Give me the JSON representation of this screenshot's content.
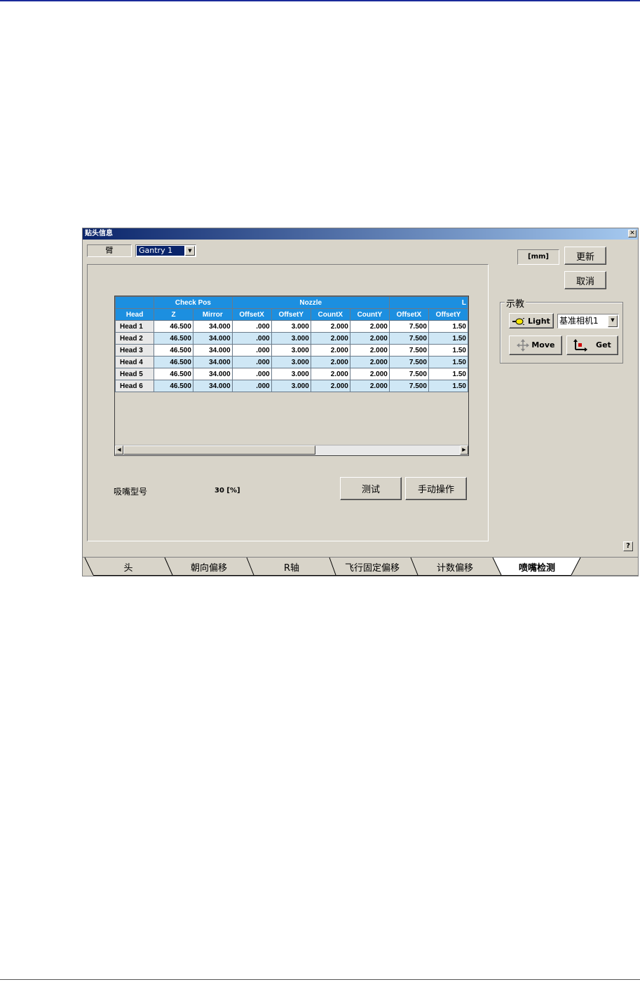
{
  "window": {
    "title": "贴头信息",
    "close_glyph": "✕"
  },
  "gantry": {
    "label": "臂",
    "selected": "Gantry 1"
  },
  "unit_label": "[mm]",
  "buttons": {
    "update": "更新",
    "cancel": "取消",
    "test": "测试",
    "manual": "手动操作",
    "help": "?"
  },
  "teach": {
    "legend": "示教",
    "light_label": "Light",
    "camera_selected": "基准相机1",
    "move_label": "Move",
    "get_label": "Get"
  },
  "table": {
    "group_headers": [
      "Check Pos",
      "Nozzle",
      "L"
    ],
    "columns": [
      "Head",
      "Z",
      "Mirror",
      "OffsetX",
      "OffsetY",
      "CountX",
      "CountY",
      "OffsetX",
      "OffsetY"
    ],
    "rows": [
      [
        "Head 1",
        "46.500",
        "34.000",
        ".000",
        "3.000",
        "2.000",
        "2.000",
        "7.500",
        "1.50"
      ],
      [
        "Head 2",
        "46.500",
        "34.000",
        ".000",
        "3.000",
        "2.000",
        "2.000",
        "7.500",
        "1.50"
      ],
      [
        "Head 3",
        "46.500",
        "34.000",
        ".000",
        "3.000",
        "2.000",
        "2.000",
        "7.500",
        "1.50"
      ],
      [
        "Head 4",
        "46.500",
        "34.000",
        ".000",
        "3.000",
        "2.000",
        "2.000",
        "7.500",
        "1.50"
      ],
      [
        "Head 5",
        "46.500",
        "34.000",
        ".000",
        "3.000",
        "2.000",
        "2.000",
        "7.500",
        "1.50"
      ],
      [
        "Head 6",
        "46.500",
        "34.000",
        ".000",
        "3.000",
        "2.000",
        "2.000",
        "7.500",
        "1.50"
      ]
    ]
  },
  "nozzle_type": {
    "label": "吸嘴型号",
    "value": "30 [%]"
  },
  "tabs": [
    "头",
    "朝向偏移",
    "R轴",
    "飞行固定偏移",
    "计数偏移",
    "喷嘴检测"
  ],
  "active_tab": "喷嘴检测",
  "colors": {
    "header_blue": "#1c8fe0",
    "title_bar": "#0a246a",
    "row_alt": "#cfe7f5"
  }
}
